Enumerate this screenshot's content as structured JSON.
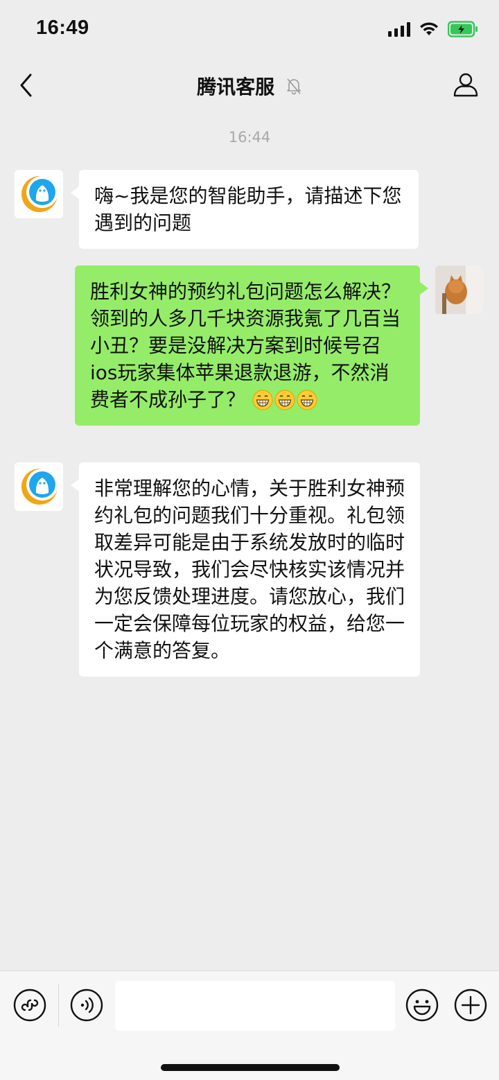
{
  "status": {
    "time": "16:49"
  },
  "header": {
    "title": "腾讯客服"
  },
  "chat": {
    "timestamp": "16:44",
    "messages": [
      {
        "sender": "service",
        "text": "嗨~我是您的智能助手，请描述下您遇到的问题"
      },
      {
        "sender": "user",
        "text": "胜利女神的预约礼包问题怎么解决？领到的人多几千块资源我氪了几百当小丑？要是没解决方案到时候号召ios玩家集体苹果退款退游，不然消费者不成孙子了？",
        "emoji": [
          "grinning-emoji",
          "grinning-emoji",
          "grinning-emoji"
        ]
      },
      {
        "sender": "service",
        "text": "非常理解您的心情，关于胜利女神预约礼包的问题我们十分重视。礼包领取差异可能是由于系统发放时的临时状况导致，我们会尽快核实该情况并为您反馈处理进度。请您放心，我们一定会保障每位玩家的权益，给您一个满意的答复。"
      }
    ]
  },
  "input": {
    "value": "",
    "placeholder": ""
  },
  "colors": {
    "user_bubble": "#95ec69",
    "service_bubble": "#ffffff",
    "background": "#ededed",
    "battery": "#35c759"
  },
  "icons": [
    "back-arrow-icon",
    "mute-bell-icon",
    "profile-icon",
    "service-avatar-icon",
    "mini-program-icon",
    "voice-icon",
    "emoji-icon",
    "plus-icon"
  ]
}
